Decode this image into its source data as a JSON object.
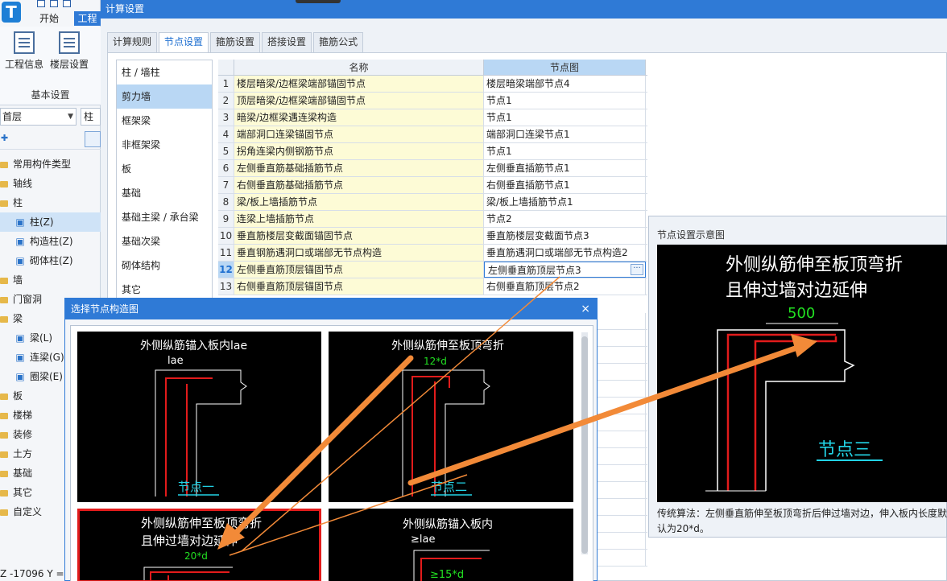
{
  "app": {
    "logo_text": "T",
    "ribbon_tabs": [
      "开始",
      "工程"
    ],
    "ribbon_buttons": [
      "工程信息",
      "楼层设置"
    ],
    "ribbon_group": "基本设置",
    "floor_value": "首层",
    "kind_value": "柱",
    "tree": [
      {
        "label": "常用构件类型",
        "level": 1
      },
      {
        "label": "轴线",
        "level": 1
      },
      {
        "label": "柱",
        "level": 1
      },
      {
        "label": "柱(Z)",
        "level": 2,
        "selected": true,
        "icon": "column-icon"
      },
      {
        "label": "构造柱(Z)",
        "level": 2,
        "icon": "constructional-column-icon"
      },
      {
        "label": "砌体柱(Z)",
        "level": 2,
        "icon": "masonry-column-icon"
      },
      {
        "label": "墙",
        "level": 1
      },
      {
        "label": "门窗洞",
        "level": 1
      },
      {
        "label": "梁",
        "level": 1
      },
      {
        "label": "梁(L)",
        "level": 2,
        "icon": "beam-icon"
      },
      {
        "label": "连梁(G)",
        "level": 2,
        "icon": "coupling-beam-icon"
      },
      {
        "label": "圈梁(E)",
        "level": 2,
        "icon": "ring-beam-icon"
      },
      {
        "label": "板",
        "level": 1
      },
      {
        "label": "楼梯",
        "level": 1
      },
      {
        "label": "装修",
        "level": 1
      },
      {
        "label": "土方",
        "level": 1
      },
      {
        "label": "基础",
        "level": 1
      },
      {
        "label": "其它",
        "level": 1
      },
      {
        "label": "自定义",
        "level": 1
      }
    ],
    "status_text": "Z -17096 Y ="
  },
  "window": {
    "title": "计算设置",
    "tabs": [
      "计算规则",
      "节点设置",
      "箍筋设置",
      "搭接设置",
      "箍筋公式"
    ],
    "active_tab": 1
  },
  "categories": [
    "柱 / 墙柱",
    "剪力墙",
    "框架梁",
    "非框架梁",
    "板",
    "基础",
    "基础主梁 / 承台梁",
    "基础次梁",
    "砌体结构",
    "其它"
  ],
  "selected_category": 1,
  "grid": {
    "headers": {
      "name": "名称",
      "node": "节点图"
    },
    "rows": [
      {
        "num": "1",
        "name": "楼层暗梁/边框梁端部锚固节点",
        "node": "楼层暗梁端部节点4"
      },
      {
        "num": "2",
        "name": "顶层暗梁/边框梁端部锚固节点",
        "node": "节点1"
      },
      {
        "num": "3",
        "name": "暗梁/边框梁遇连梁构造",
        "node": "节点1"
      },
      {
        "num": "4",
        "name": "端部洞口连梁锚固节点",
        "node": "端部洞口连梁节点1"
      },
      {
        "num": "5",
        "name": "拐角连梁内侧钢筋节点",
        "node": "节点1"
      },
      {
        "num": "6",
        "name": "左侧垂直筋基础插筋节点",
        "node": "左侧垂直插筋节点1"
      },
      {
        "num": "7",
        "name": "右侧垂直筋基础插筋节点",
        "node": "右侧垂直插筋节点1"
      },
      {
        "num": "8",
        "name": "梁/板上墙插筋节点",
        "node": "梁/板上墙插筋节点1"
      },
      {
        "num": "9",
        "name": "连梁上墙插筋节点",
        "node": "节点2"
      },
      {
        "num": "10",
        "name": "垂直筋楼层变截面锚固节点",
        "node": "垂直筋楼层变截面节点3"
      },
      {
        "num": "11",
        "name": "垂直钢筋遇洞口或端部无节点构造",
        "node": "垂直筋遇洞口或端部无节点构造2"
      },
      {
        "num": "12",
        "name": "左侧垂直筋顶层锚固节点",
        "node": "左侧垂直筋顶层节点3",
        "selected": true
      },
      {
        "num": "13",
        "name": "右侧垂直筋顶层锚固节点",
        "node": "右侧垂直筋顶层节点2"
      }
    ],
    "tail_partial": [
      {
        "row": 6,
        "text": "点1"
      },
      {
        "row": 14,
        "text": "造_点构造2"
      }
    ]
  },
  "preview": {
    "title": "节点设置示意图",
    "line1": "外侧纵筋伸至板顶弯折",
    "line2": "且伸过墙对边延伸",
    "dim": "500",
    "node_label": "节点三",
    "desc": "传统算法：左侧垂直筋伸至板顶弯折后伸过墙对边，伸入板内长度默认为20*d。"
  },
  "select_dialog": {
    "title": "选择节点构造图",
    "close_glyph": "×",
    "cards": [
      {
        "caption": "外侧纵筋锚入板内lae",
        "dim": "lae",
        "label": "节点一"
      },
      {
        "caption": "外侧纵筋伸至板顶弯折",
        "dim": "12*d",
        "label": "节点二"
      },
      {
        "caption1": "外侧纵筋伸至板顶弯折",
        "caption2": "且伸过墙对边延伸",
        "dim": "20*d",
        "selected": true
      },
      {
        "caption": "外侧纵筋锚入板内",
        "dim": "≥lae",
        "dim2": "≥15*d"
      }
    ]
  },
  "colors": {
    "title_bar": "#2f7ad6",
    "cad_text": "#ffffff",
    "cad_dim": "#22e022",
    "cad_label": "#22d3e6",
    "rebar": "#e21b1b",
    "arrow": "#f28a38"
  }
}
